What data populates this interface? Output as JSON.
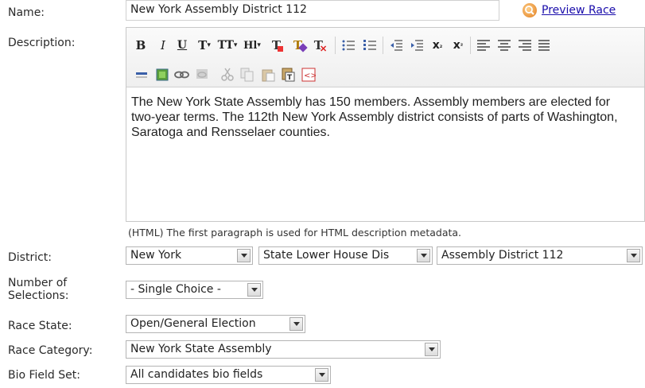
{
  "labels": {
    "name": "Name:",
    "description": "Description:",
    "district": "District:",
    "num_selections": "Number of\nSelections:",
    "race_state": "Race State:",
    "race_category": "Race Category:",
    "bio_field_set": "Bio Field Set:"
  },
  "name_value": "New York Assembly District 112",
  "preview_link": "Preview Race",
  "editor": {
    "toolbar_row1": [
      "B",
      "I",
      "U",
      "T▾",
      "TT▾",
      "H1▾",
      "T",
      "T",
      "T",
      "ul",
      "ol",
      "outdent",
      "indent",
      "x₂",
      "x²",
      "left",
      "center",
      "right"
    ],
    "text": "The New York State Assembly has 150 members. Assembly members are elected for two-year terms. The 112th New York Assembly district consists of parts of Washington, Saratoga and Rensselaer counties.",
    "hint": "(HTML) The first paragraph is used for HTML description metadata."
  },
  "district": {
    "state": "New York",
    "type": "State Lower House Dis",
    "district": "Assembly District 112"
  },
  "num_selections": "- Single Choice -",
  "race_state": "Open/General Election",
  "race_category": "New York State Assembly",
  "bio_field_set": "All candidates bio fields",
  "colors": {
    "link": "#1a0dab",
    "accent": "#e07b1a",
    "border": "#b8b8b8"
  }
}
